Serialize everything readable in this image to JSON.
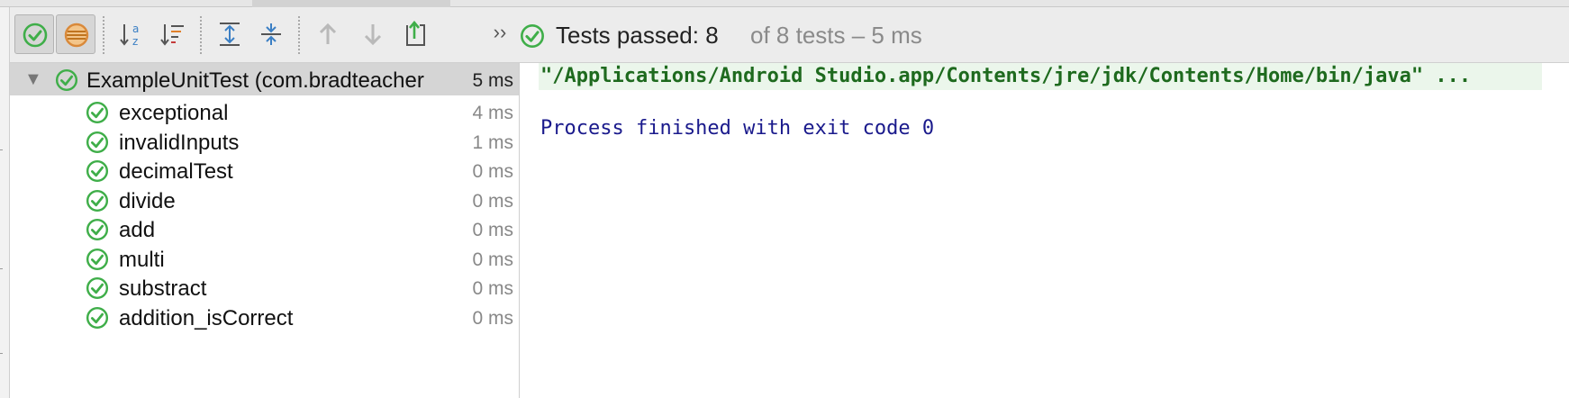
{
  "toolbar": {
    "icons": [
      "show-passed-icon",
      "show-ignored-icon",
      "sort-alphabetically-icon",
      "sort-by-duration-icon",
      "expand-all-icon",
      "collapse-all-icon",
      "previous-failed-icon",
      "next-failed-icon",
      "export-results-icon",
      "more-icon"
    ],
    "more_glyph": "››"
  },
  "status": {
    "label": "Tests passed: 8",
    "rest": "of 8 tests – 5 ms"
  },
  "tree": {
    "root": {
      "name": "ExampleUnitTest (com.bradteacher",
      "time": "5 ms"
    },
    "items": [
      {
        "name": "exceptional",
        "time": "4 ms"
      },
      {
        "name": "invalidInputs",
        "time": "1 ms"
      },
      {
        "name": "decimalTest",
        "time": "0 ms"
      },
      {
        "name": "divide",
        "time": "0 ms"
      },
      {
        "name": "add",
        "time": "0 ms"
      },
      {
        "name": "multi",
        "time": "0 ms"
      },
      {
        "name": "substract",
        "time": "0 ms"
      },
      {
        "name": "addition_isCorrect",
        "time": "0 ms"
      }
    ]
  },
  "console": {
    "command": "\"/Applications/Android Studio.app/Contents/jre/jdk/Contents/Home/bin/java\" ...",
    "exit": "Process finished with exit code 0"
  },
  "colors": {
    "pass_green": "#3fae49",
    "toolbar_bg": "#ececec",
    "selection_bg": "#d5d5d5",
    "console_cmd_bg": "#ebf6eb",
    "console_exit_text": "#1a1a8c"
  }
}
